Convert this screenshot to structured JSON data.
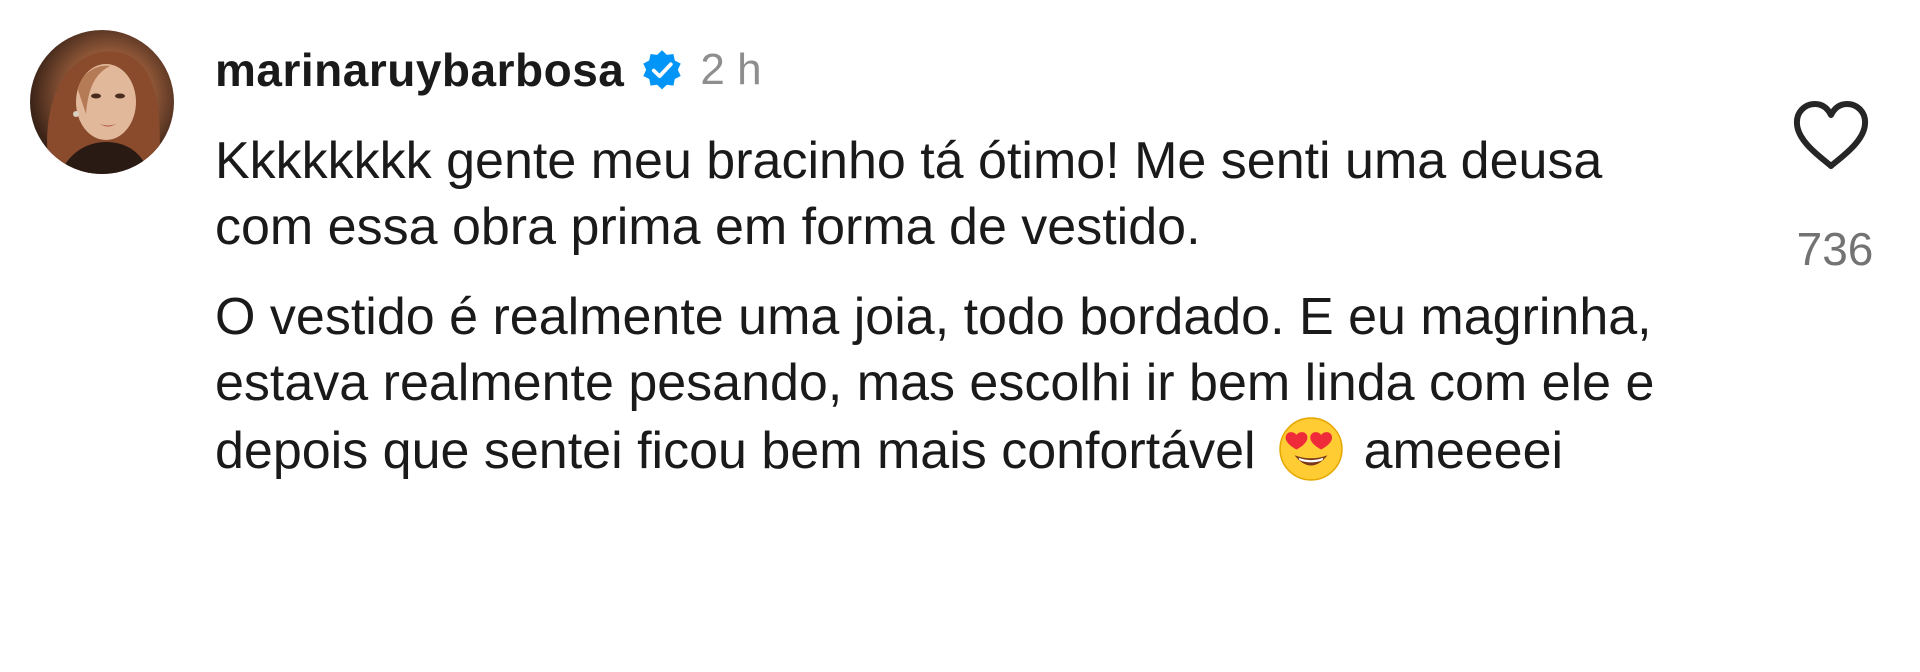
{
  "comment": {
    "username": "marinaruybarbosa",
    "timestamp": "2 h",
    "paragraphs": {
      "first": "Kkkkkkkk gente meu bracinho tá ótimo! Me senti uma deusa com essa obra prima em forma de vestido.",
      "second_before_emoji": "O vestido é realmente uma joia, todo bordado. E eu magrinha, estava realmente pesando, mas escolhi ir bem linda com ele e depois que sentei ficou bem mais confortável",
      "second_after_emoji": "ameeeei"
    },
    "emoji": "heart-eyes-emoji",
    "like_count": "736"
  },
  "icons": {
    "verified": "verified-badge-icon",
    "like": "heart-outline-icon"
  },
  "colors": {
    "verified_blue": "#0095f6",
    "timestamp_gray": "#8e8e8e",
    "text": "#1a1a1a"
  }
}
